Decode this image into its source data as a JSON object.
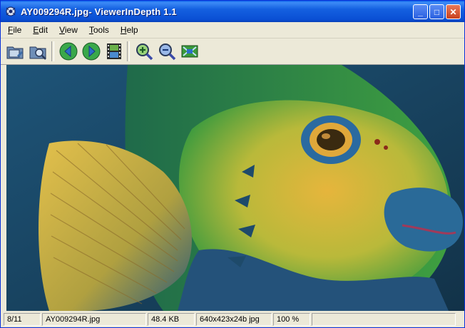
{
  "window": {
    "title": "AY009294R.jpg- ViewerInDepth 1.1",
    "controls": {
      "minimize": "_",
      "maximize": "□",
      "close": "✕"
    }
  },
  "menu": {
    "items": [
      {
        "label": "File",
        "key": "F",
        "rest": "ile"
      },
      {
        "label": "Edit",
        "key": "E",
        "rest": "dit"
      },
      {
        "label": "View",
        "key": "V",
        "rest": "iew"
      },
      {
        "label": "Tools",
        "key": "T",
        "rest": "ools"
      },
      {
        "label": "Help",
        "key": "H",
        "rest": "elp"
      }
    ]
  },
  "toolbar": {
    "icons": [
      "open-folder-icon",
      "browse-folder-icon",
      "previous-arrow-icon",
      "next-arrow-icon",
      "slideshow-film-icon",
      "zoom-in-icon",
      "zoom-out-icon",
      "fit-to-window-icon"
    ]
  },
  "image": {
    "description_icon": "fish-photo-image",
    "colors": {
      "water": "#1b4766",
      "body_green": "#3c9c3a",
      "yellow": "#e0b43a",
      "blue": "#2a5a80"
    }
  },
  "status": {
    "index": "8/11",
    "filename": "AY009294R.jpg",
    "filesize": "48.4 KB",
    "dimensions": "640x423x24b jpg",
    "zoom": "100 %"
  }
}
